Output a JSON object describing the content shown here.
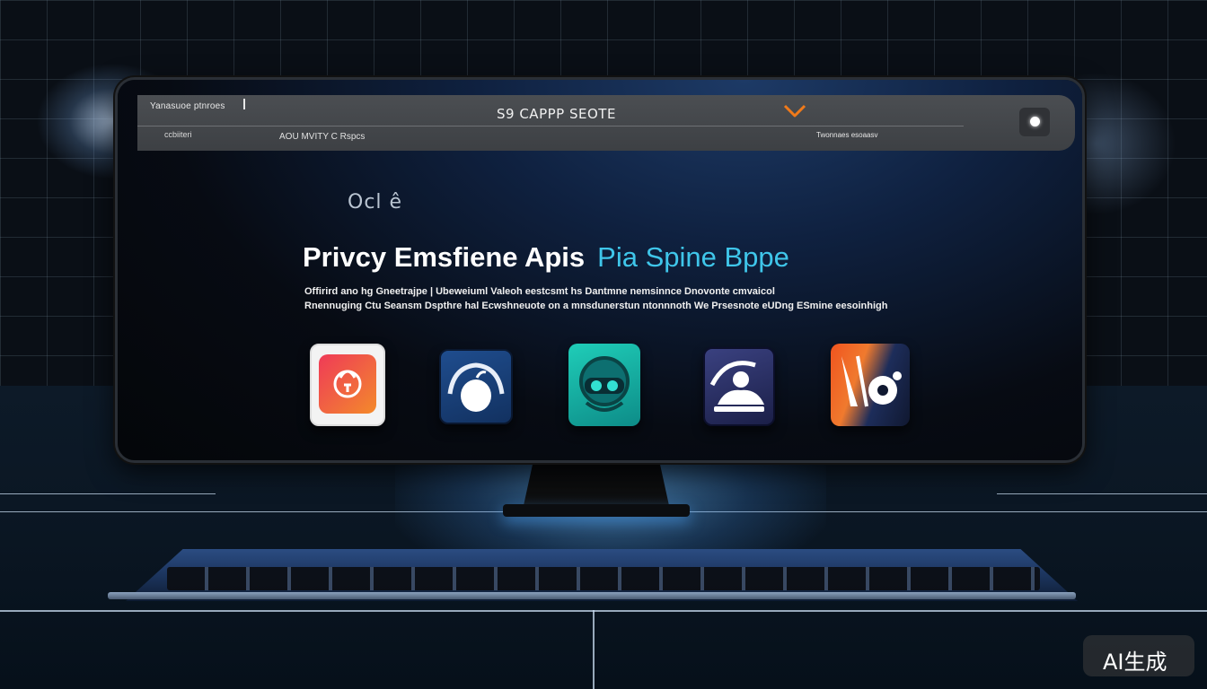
{
  "topbar": {
    "site_label": "Yanasuoe ptnroes",
    "title": "S9 CAPPP SEOTE",
    "nav_left": "ccbiiteri",
    "nav_center": "AOU MVITY C Rspcs",
    "right_label": "Twonnaes esoaasv"
  },
  "content": {
    "small_logo": "Ocl ê",
    "headline": "Privcy Emsfiene Apis",
    "headline_accent": "Pia Spine Bppe",
    "subtext_line1": "Offirird ano hg Gneetrajpe | Ubeweiuml Valeoh eestcsmt hs Dantmne nemsinnce Dnovonte cmvaicol",
    "subtext_line2": "Rnennuging Ctu Seansm Dspthre hal Ecwshneuote on a mnsdunerstun ntonnnoth We Prsesnote eUDng ESmine eesoinhigh"
  },
  "apps": [
    {
      "name": "red-app",
      "color": "#ef4a45"
    },
    {
      "name": "blue-apple-app",
      "color": "#1f4d8e"
    },
    {
      "name": "teal-vr-app",
      "color": "#1fcdb8"
    },
    {
      "name": "purple-figure-app",
      "color": "#3a4180"
    },
    {
      "name": "orange-media-app",
      "color": "#f0541f"
    }
  ],
  "watermark": {
    "text": "AI生成"
  },
  "colors": {
    "accent": "#3fc6ea",
    "chevron": "#f07a1a"
  }
}
